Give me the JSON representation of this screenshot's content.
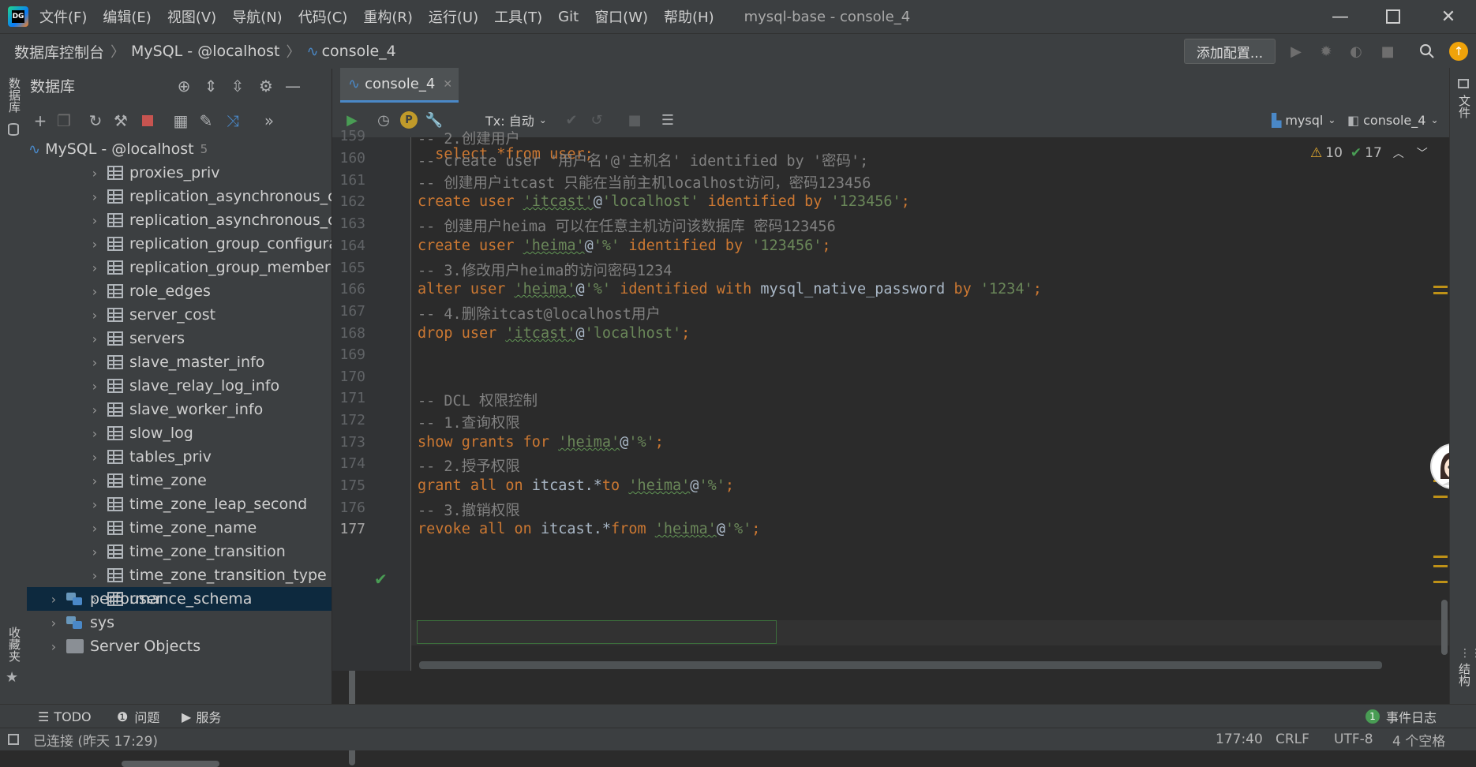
{
  "app": {
    "logo_text": "DG",
    "menu": [
      "文件(F)",
      "编辑(E)",
      "视图(V)",
      "导航(N)",
      "代码(C)",
      "重构(R)",
      "运行(U)",
      "工具(T)",
      "Git",
      "窗口(W)",
      "帮助(H)"
    ],
    "window_title": "mysql-base - console_4"
  },
  "nav": {
    "breadcrumb": [
      "数据库控制台",
      "MySQL - @localhost",
      "console_4"
    ],
    "add_config_label": "添加配置..."
  },
  "left_strip": {
    "top_label": "数据库",
    "bottom_label": "收藏夹"
  },
  "right_strip": {
    "top_label": "文件",
    "bottom_label": "结构"
  },
  "db_panel": {
    "title": "数据库",
    "root": {
      "label": "MySQL - @localhost",
      "count": "5"
    },
    "tables": [
      "proxies_priv",
      "replication_asynchronous_c",
      "replication_asynchronous_c",
      "replication_group_configura",
      "replication_group_member",
      "role_edges",
      "server_cost",
      "servers",
      "slave_master_info",
      "slave_relay_log_info",
      "slave_worker_info",
      "slow_log",
      "tables_priv",
      "time_zone",
      "time_zone_leap_second",
      "time_zone_name",
      "time_zone_transition",
      "time_zone_transition_type",
      "user"
    ],
    "schemas": [
      "performance_schema",
      "sys"
    ],
    "server_objects": "Server Objects"
  },
  "editor": {
    "tab_label": "console_4",
    "tx_label": "Tx: 自动",
    "datasource": "mysql",
    "session": "console_4",
    "warnings": "10",
    "weak_warnings": "17",
    "partial_line": "select *from user;",
    "line_numbers": [
      "159",
      "160",
      "161",
      "162",
      "163",
      "164",
      "165",
      "166",
      "167",
      "168",
      "169",
      "170",
      "171",
      "172",
      "173",
      "174",
      "175",
      "176",
      "177"
    ],
    "lines": {
      "l159": "-- 2.创建用户",
      "l160": "-- create user '用户名'@'主机名' identified by '密码';",
      "l161": "-- 创建用户itcast 只能在当前主机localhost访问，密码123456",
      "l162_a": "create user ",
      "l162_b": "'itcast'",
      "l162_c": "@",
      "l162_d": "'localhost'",
      "l162_e": " identified by ",
      "l162_f": "'123456'",
      "l162_g": ";",
      "l163": "-- 创建用户heima 可以在任意主机访问该数据库 密码123456",
      "l164_a": "create user ",
      "l164_b": "'heima'",
      "l164_c": "@",
      "l164_d": "'%'",
      "l164_e": " identified by ",
      "l164_f": "'123456'",
      "l164_g": ";",
      "l165": "-- 3.修改用户heima的访问密码1234",
      "l166_a": "alter user ",
      "l166_b": "'heima'",
      "l166_c": "@",
      "l166_d": "'%'",
      "l166_e": " identified with ",
      "l166_f": "mysql_native_password",
      "l166_g": " by ",
      "l166_h": "'1234'",
      "l166_i": ";",
      "l167": "-- 4.删除itcast@localhost用户",
      "l168_a": "drop user ",
      "l168_b": "'itcast'",
      "l168_c": "@",
      "l168_d": "'localhost'",
      "l168_e": ";",
      "l171": "-- DCL 权限控制",
      "l172": "-- 1.查询权限",
      "l173_a": "show grants for ",
      "l173_b": "'heima'",
      "l173_c": "@",
      "l173_d": "'%'",
      "l173_e": ";",
      "l174": "-- 2.授予权限",
      "l175_a": "grant all on ",
      "l175_b": "itcast.*",
      "l175_c": "to ",
      "l175_d": "'heima'",
      "l175_e": "@",
      "l175_f": "'%'",
      "l175_g": ";",
      "l176": "-- 3.撤销权限",
      "l177_a": "revoke all on ",
      "l177_b": "itcast.*",
      "l177_c": "from ",
      "l177_d": "'heima'",
      "l177_e": "@",
      "l177_f": "'%'",
      "l177_g": ";"
    }
  },
  "tool_tabs": {
    "todo": "TODO",
    "problems": "问题",
    "services": "服务",
    "event_log": "事件日志",
    "event_count": "1"
  },
  "status": {
    "connection": "已连接 (昨天 17:29)",
    "position": "177:40",
    "line_sep": "CRLF",
    "encoding": "UTF-8",
    "indent": "4 个空格"
  },
  "colors": {
    "keyword": "#cc7832",
    "string": "#6a8759",
    "comment": "#808080",
    "selection": "#0d293e",
    "run_green": "#499c54",
    "stop_red": "#c75450"
  }
}
